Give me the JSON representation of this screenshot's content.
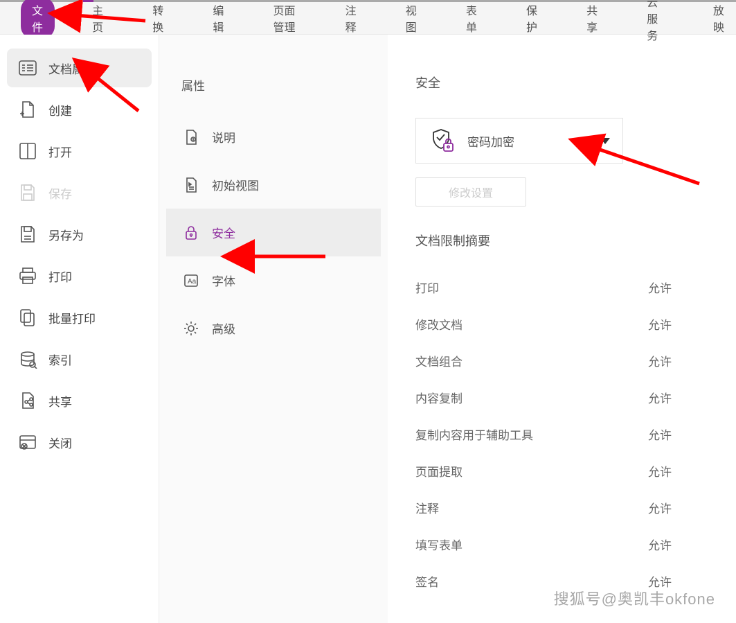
{
  "menubar": {
    "tabs": [
      "文件",
      "主页",
      "转换",
      "编辑",
      "页面管理",
      "注释",
      "视图",
      "表单",
      "保护",
      "共享",
      "云服务",
      "放映"
    ],
    "active_index": 0
  },
  "sidebar": {
    "items": [
      {
        "label": "文档属性",
        "active": true
      },
      {
        "label": "创建"
      },
      {
        "label": "打开"
      },
      {
        "label": "保存",
        "disabled": true
      },
      {
        "label": "另存为"
      },
      {
        "label": "打印"
      },
      {
        "label": "批量打印"
      },
      {
        "label": "索引"
      },
      {
        "label": "共享"
      },
      {
        "label": "关闭"
      }
    ]
  },
  "midpanel": {
    "title": "属性",
    "items": [
      {
        "label": "说明"
      },
      {
        "label": "初始视图"
      },
      {
        "label": "安全",
        "active": true
      },
      {
        "label": "字体"
      },
      {
        "label": "高级"
      }
    ]
  },
  "security": {
    "title": "安全",
    "encryption_label": "密码加密",
    "modify_button": "修改设置",
    "restrictions_title": "文档限制摘要",
    "rows": [
      {
        "name": "打印",
        "value": "允许"
      },
      {
        "name": "修改文档",
        "value": "允许"
      },
      {
        "name": "文档组合",
        "value": "允许"
      },
      {
        "name": "内容复制",
        "value": "允许"
      },
      {
        "name": "复制内容用于辅助工具",
        "value": "允许"
      },
      {
        "name": "页面提取",
        "value": "允许"
      },
      {
        "name": "注释",
        "value": "允许"
      },
      {
        "name": "填写表单",
        "value": "允许"
      },
      {
        "name": "签名",
        "value": "允许"
      }
    ]
  },
  "watermark": "搜狐号@奥凯丰okfone"
}
